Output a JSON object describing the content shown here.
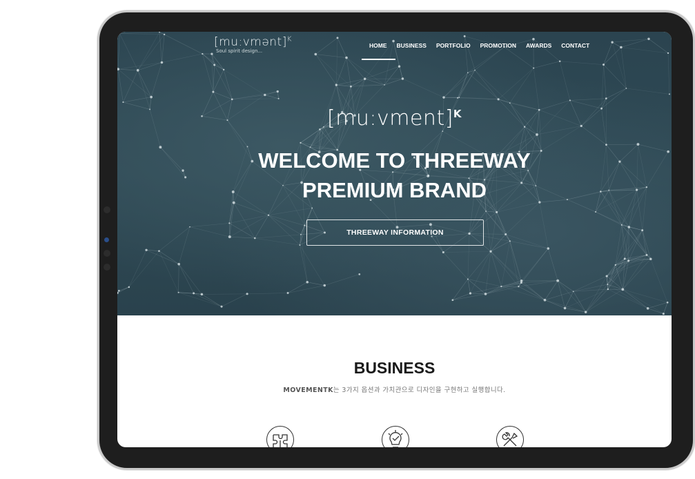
{
  "nav": {
    "logo": {
      "text": "[mu:vmənt]",
      "sup": "K",
      "tagline": "Soul spirit design..."
    },
    "items": [
      {
        "label": "HOME",
        "active": true
      },
      {
        "label": "BUSINESS"
      },
      {
        "label": "PORTFOLIO"
      },
      {
        "label": "PROMOTION"
      },
      {
        "label": "AWARDS"
      },
      {
        "label": "CONTACT"
      }
    ]
  },
  "hero": {
    "brand": "[mu:vment]",
    "brand_sup": "K",
    "title_line1": "WELCOME TO THREEWAY",
    "title_line2": "PREMIUM BRAND",
    "button_label": "THREEWAY INFORMATION"
  },
  "business": {
    "title": "BUSINESS",
    "subtitle_bold": "MOVEMENTK",
    "subtitle_rest": "는 3가지 옵션과 가치관으로 디자인을 구현하고 실행합니다.",
    "icons": [
      "puzzle-icon",
      "lightbulb-check-icon",
      "tools-icon"
    ]
  },
  "colors": {
    "hero_bg": "#2f4a55",
    "device_frame": "#1e1e1e"
  }
}
